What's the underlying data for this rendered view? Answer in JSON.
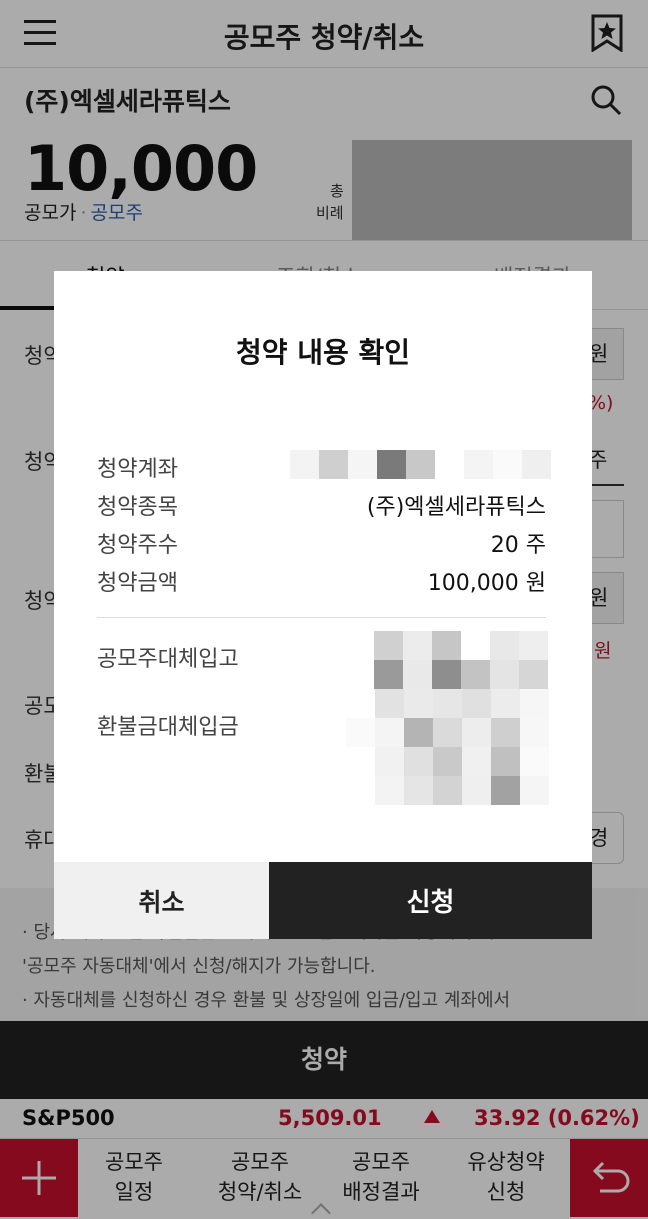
{
  "header": {
    "title": "공모주 청약/취소",
    "menu_icon": "hamburger-icon",
    "bookmark_icon": "bookmark-star-icon"
  },
  "stock": {
    "name": "(주)엑셀세라퓨틱스",
    "price": "10,000",
    "price_label": "공모가",
    "type_label": "공모주",
    "side_labels": [
      "총",
      "비례"
    ]
  },
  "tabs": [
    {
      "label": "청약",
      "active": true
    },
    {
      "label": "조회/취소",
      "active": false
    },
    {
      "label": "배정결과",
      "active": false
    }
  ],
  "form": {
    "rows": [
      "청약",
      "청약",
      "청약",
      "공모",
      "환불",
      "휴대"
    ],
    "right_values": [
      "원",
      "%)",
      "주",
      "원",
      "원",
      "경"
    ]
  },
  "notes": [
    "· 당사 계좌로 입고/입금을 원하시면 ... 입고계좌를 지정해 주세요.",
    "'공모주 자동대체'에서 신청/해지가 가능합니다.",
    "· 자동대체를 신청하신 경우 환불 및 상장일에 입금/입고 계좌에서"
  ],
  "submit_label": "청약",
  "ticker": {
    "name": "S&P500",
    "value": "5,509.01",
    "change": "33.92 (0.62%)",
    "direction": "up",
    "color": "#c8102e"
  },
  "bottom_nav": {
    "items": [
      {
        "line1": "공모주",
        "line2": "일정"
      },
      {
        "line1": "공모주",
        "line2": "청약/취소"
      },
      {
        "line1": "공모주",
        "line2": "배정결과"
      },
      {
        "line1": "유상청약",
        "line2": "신청"
      }
    ],
    "plus_icon": "plus-icon",
    "back_icon": "back-arrow-icon"
  },
  "modal": {
    "title": "청약 내용 확인",
    "rows": [
      {
        "label": "청약계좌",
        "value": ""
      },
      {
        "label": "청약종목",
        "value": "(주)엑셀세라퓨틱스"
      },
      {
        "label": "청약주수",
        "value": "20 주"
      },
      {
        "label": "청약금액",
        "value": "100,000 원"
      }
    ],
    "transfer_rows": [
      {
        "label": "공모주대체입고"
      },
      {
        "label": "환불금대체입금"
      }
    ],
    "cancel_label": "취소",
    "apply_label": "신청"
  },
  "colors": {
    "accent": "#c8102e",
    "dark": "#222222",
    "link_blue": "#2a5db0"
  }
}
